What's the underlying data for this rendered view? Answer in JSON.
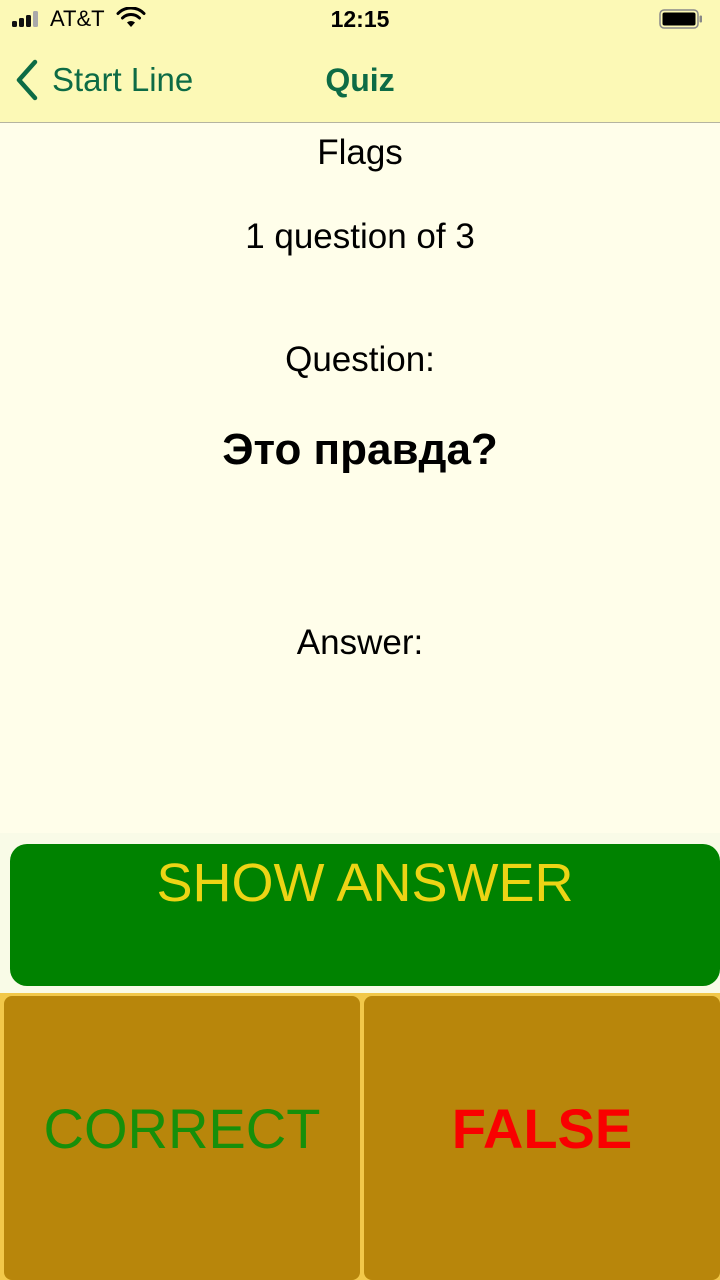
{
  "status_bar": {
    "carrier": "AT&T",
    "time": "12:15",
    "icons": [
      "signal-icon",
      "wifi-icon",
      "battery-icon"
    ]
  },
  "nav": {
    "back_label": "Start Line",
    "back_icon": "chevron-left-icon",
    "title": "Quiz"
  },
  "quiz": {
    "category": "Flags",
    "progress": "1 question of 3",
    "question_label": "Question:",
    "question_text": "Это правда?",
    "answer_label": "Answer:"
  },
  "actions": {
    "show_answer": "SHOW ANSWER",
    "correct": "CORRECT",
    "false": "FALSE"
  },
  "colors": {
    "bar_background": "#fcf9b6",
    "page_background": "#fffeea",
    "accent": "#0d6b45",
    "show_answer_bg": "#008200",
    "show_answer_text": "#ecd415",
    "grade_button_bg": "#b8860b",
    "correct_text": "#178f0a",
    "false_text": "#f90000"
  }
}
